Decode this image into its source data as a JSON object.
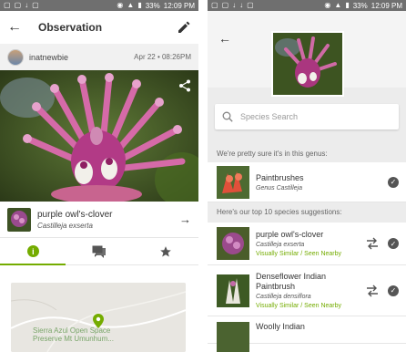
{
  "left": {
    "status_bar": {
      "battery": "33%",
      "time": "12:09 PM"
    },
    "app_bar": {
      "title": "Observation"
    },
    "user": {
      "name": "inatnewbie",
      "date": "Apr 22 • 08:26PM"
    },
    "taxon": {
      "common_name": "purple owl's-clover",
      "scientific_name": "Castilleja exserta"
    },
    "tabs": [
      {
        "name": "info",
        "icon": "info-icon",
        "selected": true
      },
      {
        "name": "comments",
        "icon": "comments-icon",
        "selected": false
      },
      {
        "name": "favorites",
        "icon": "star-icon",
        "selected": false
      }
    ],
    "map": {
      "label_line1": "Sierra Azul Open Space",
      "label_line2": "Preserve Mt Umunhum..."
    },
    "colors": {
      "accent": "#74ac00",
      "status_bar": "#6f6f6f"
    }
  },
  "right": {
    "status_bar": {
      "battery": "33%",
      "time": "12:09 PM"
    },
    "search": {
      "placeholder": "Species Search"
    },
    "genus_section": {
      "heading": "We're pretty sure it's in this genus:",
      "item": {
        "name": "Paintbrushes",
        "scientific": "Genus Castilleja"
      }
    },
    "species_section": {
      "heading": "Here's our top 10 species suggestions:",
      "items": [
        {
          "name": "purple owl's-clover",
          "scientific": "Castilleja exserta",
          "evidence": "Visually Similar / Seen Nearby"
        },
        {
          "name": "Denseflower Indian Paintbrush",
          "scientific": "Castilleja densiflora",
          "evidence": "Visually Similar / Seen Nearby"
        },
        {
          "name": "Woolly Indian",
          "scientific": "",
          "evidence": ""
        }
      ]
    }
  }
}
